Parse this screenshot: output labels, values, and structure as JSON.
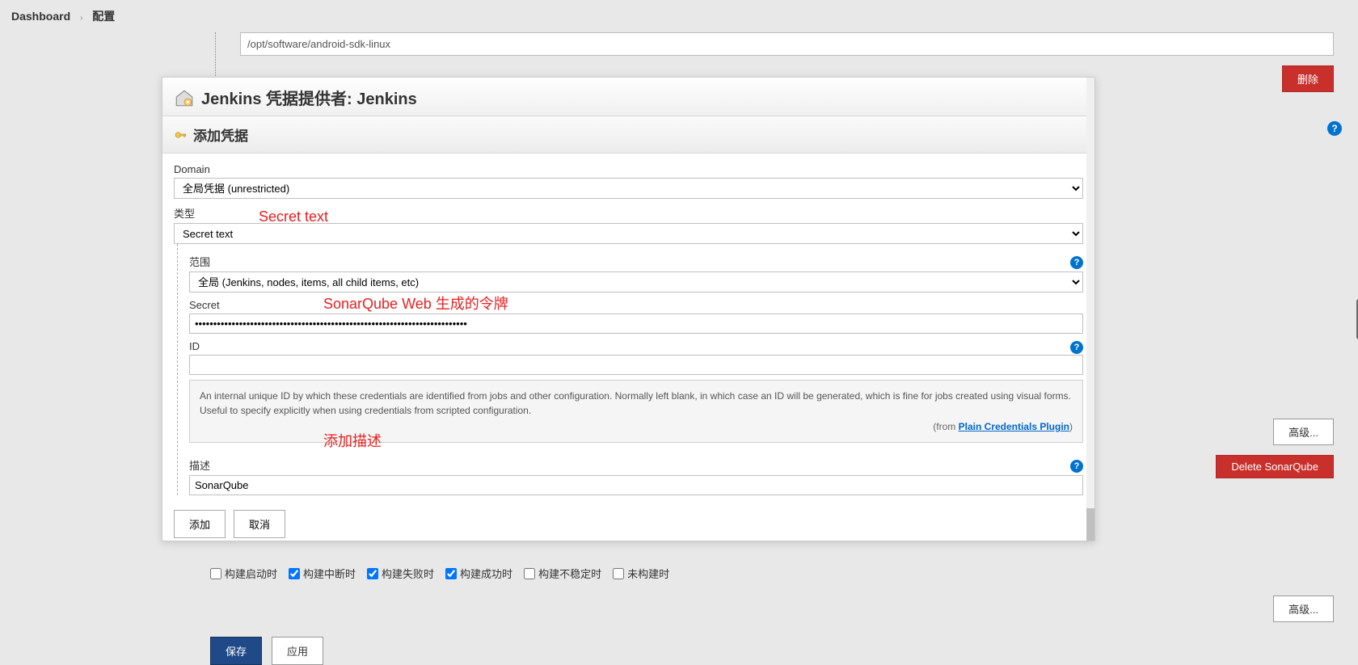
{
  "breadcrumb": {
    "dashboard": "Dashboard",
    "config": "配置"
  },
  "bg": {
    "sdk_path": "/opt/software/android-sdk-linux",
    "delete_label": "删除",
    "advanced1_label": "高级...",
    "delete_sonar_label": "Delete SonarQube",
    "advanced2_label": "高级...",
    "checkbox_row": [
      {
        "label": "构建启动时",
        "checked": false
      },
      {
        "label": "构建中断时",
        "checked": true
      },
      {
        "label": "构建失败时",
        "checked": true
      },
      {
        "label": "构建成功时",
        "checked": true
      },
      {
        "label": "构建不稳定时",
        "checked": false
      },
      {
        "label": "未构建时",
        "checked": false
      }
    ],
    "save_label": "保存",
    "apply_label": "应用"
  },
  "modal": {
    "title": "Jenkins 凭据提供者: Jenkins",
    "subtitle": "添加凭据",
    "domain_label": "Domain",
    "domain_value": "全局凭据 (unrestricted)",
    "type_label": "类型",
    "type_value": "Secret text",
    "scope_label": "范围",
    "scope_value": "全局 (Jenkins, nodes, items, all child items, etc)",
    "secret_label": "Secret",
    "secret_value": "••••••••••••••••••••••••••••••••••••••••••••••••••••••••••••••••••••••••••",
    "id_label": "ID",
    "id_value": "",
    "id_info": "An internal unique ID by which these credentials are identified from jobs and other configuration. Normally left blank, in which case an ID will be generated, which is fine for jobs created using visual forms. Useful to specify explicitly when using credentials from scripted configuration.",
    "id_from_prefix": "(from ",
    "id_from_link": "Plain Credentials Plugin",
    "id_from_suffix": ")",
    "desc_label": "描述",
    "desc_value": "SonarQube",
    "add_label": "添加",
    "cancel_label": "取消"
  },
  "annotations": {
    "a1": "Secret text",
    "a2": "SonarQube Web 生成的令牌",
    "a3": "添加描述"
  }
}
